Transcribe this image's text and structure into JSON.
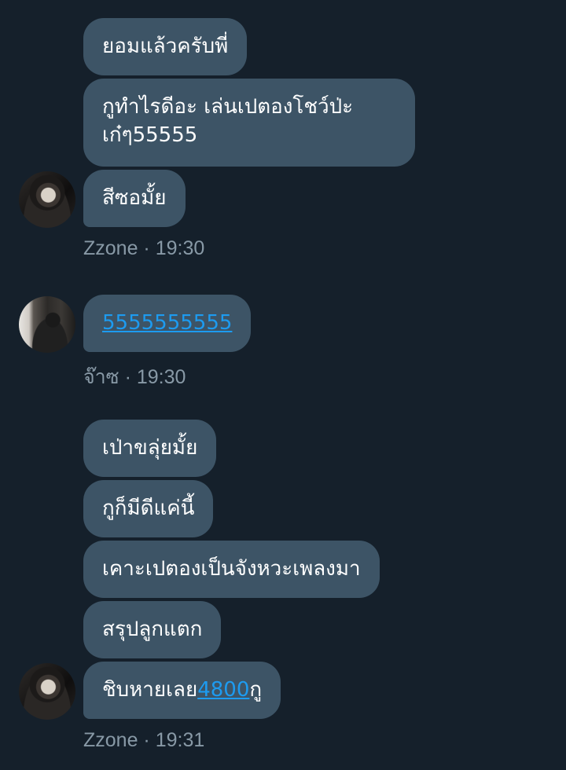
{
  "messages": {
    "m1": "ยอมแล้วครับพี่",
    "m2": "กูทำไรดีอะ เล่นเปตองโชว์ป่ะเก๋ๆ55555",
    "m3": "สีซอมั้ย",
    "m4": "5555555555",
    "m5": "เป่าขลุ่ยมั้ย",
    "m6": "กูก็มีดีแค่นี้",
    "m7": "เคาะเปตองเป็นจังหวะเพลงมา",
    "m8": "สรุปลูกแตก",
    "m9_prefix": "ชิบหายเลย",
    "m9_link": "4800",
    "m9_suffix": "กู"
  },
  "meta": {
    "group1": "Zzone · 19:30",
    "group2": "จ๊าซ · 19:30",
    "group3": "Zzone · 19:31"
  },
  "avatars": {
    "zzone": "Zzone avatar",
    "jazz": "จ๊าซ avatar"
  },
  "colors": {
    "background": "#15202b",
    "bubble": "#3d5466",
    "link": "#1d9bf0",
    "meta_text": "#8899a6"
  }
}
